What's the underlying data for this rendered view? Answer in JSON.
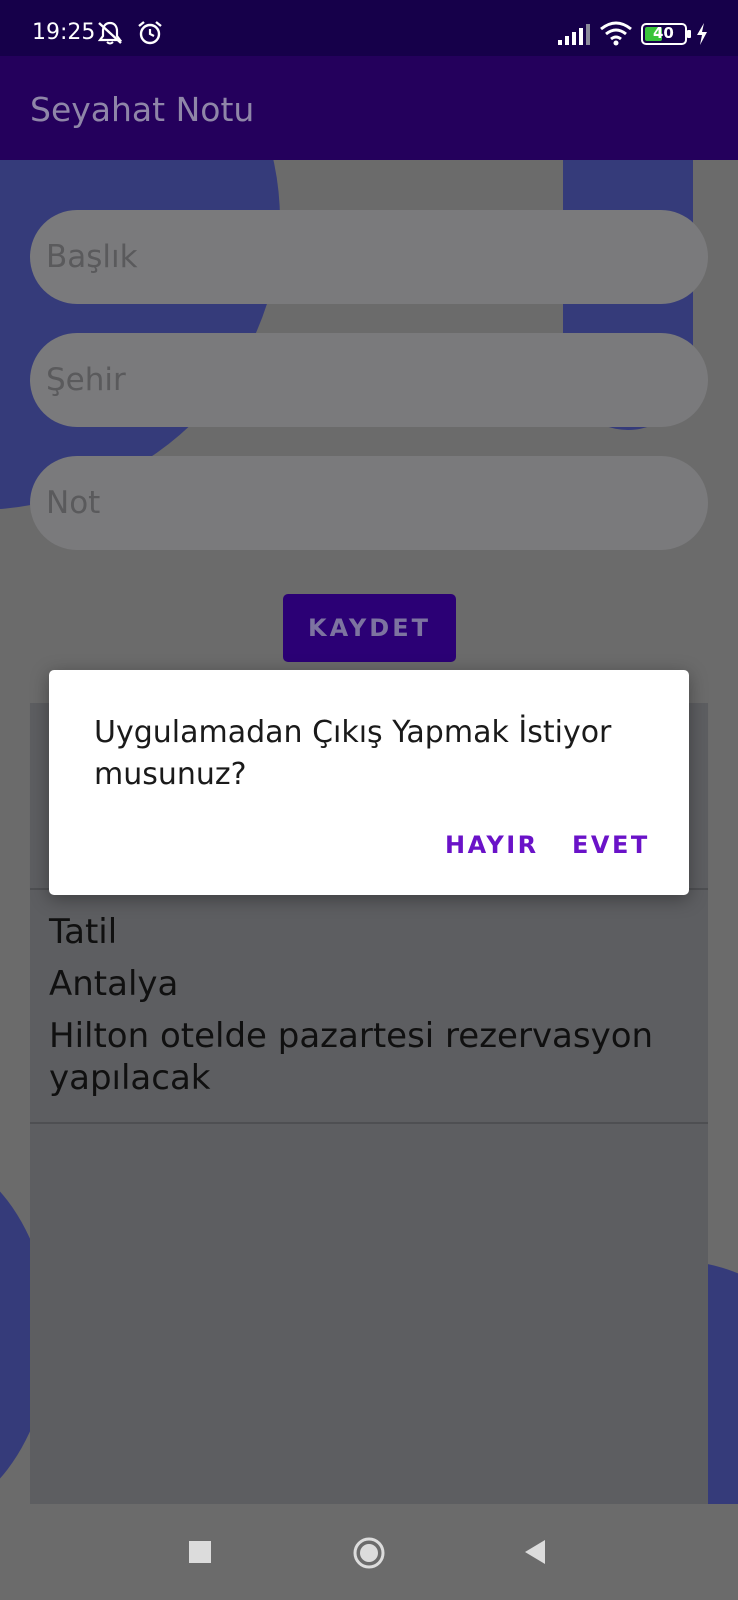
{
  "status_bar": {
    "time": "19:25",
    "battery_level": "40",
    "icons": [
      "muted-notifications-icon",
      "alarm-icon",
      "signal-icon",
      "wifi-icon",
      "battery-icon",
      "charging-icon"
    ]
  },
  "app_bar": {
    "title": "Seyahat Notu"
  },
  "form": {
    "title_placeholder": "Başlık",
    "city_placeholder": "Şehir",
    "note_placeholder": "Not",
    "save_label": "KAYDET"
  },
  "notes": [
    {
      "title": "Tatil",
      "city": "Antalya",
      "note_line1": "Hilton otelde pazartesi rezervasyon",
      "note_line2": "yapılacak"
    }
  ],
  "dialog": {
    "message_line1": "Uygulamadan Çıkış Yapmak İstiyor",
    "message_line2": "musunuz?",
    "negative_label": "HAYIR",
    "positive_label": "EVET"
  },
  "nav_bar": {
    "icons": [
      "recents-icon",
      "home-icon",
      "back-icon"
    ]
  },
  "colors": {
    "status_bar": "#16004a",
    "app_bar": "#24005c",
    "accent": "#6a12c8",
    "blob": "#353b7a",
    "scrim_background": "#6b6b6b"
  }
}
